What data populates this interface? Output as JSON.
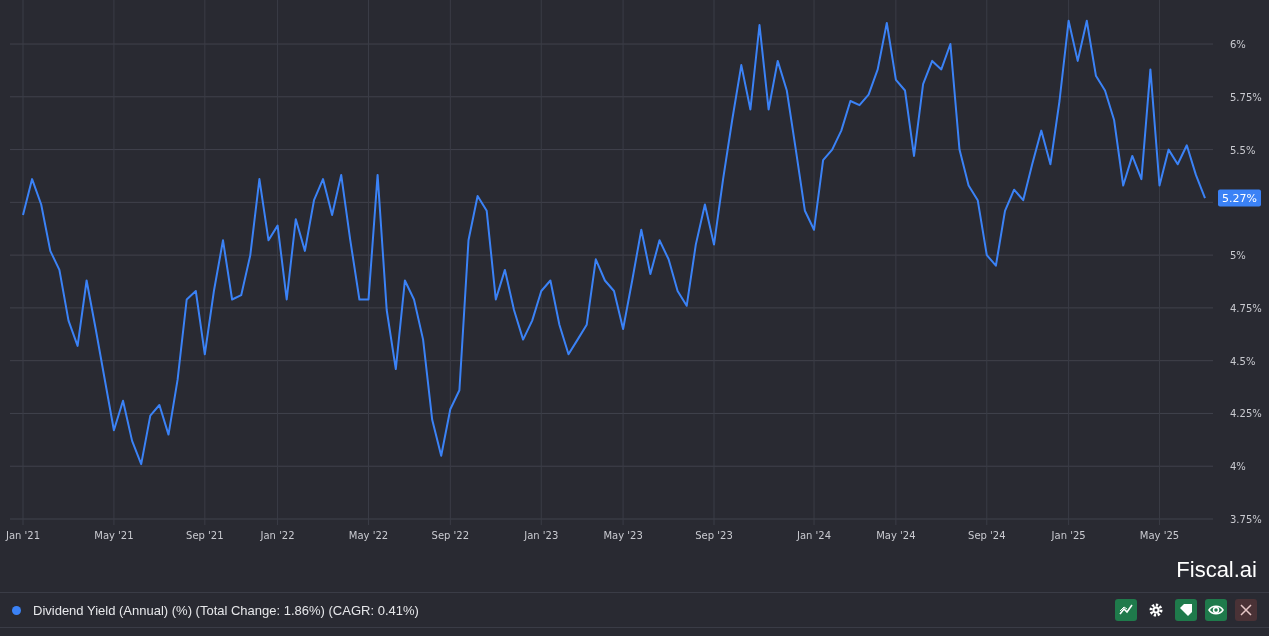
{
  "chart": {
    "chart_data": {
      "type": "line",
      "grid": true,
      "ylim": [
        3.75,
        6.2
      ],
      "yticks": [
        {
          "value": 3.75,
          "label": "3.75%"
        },
        {
          "value": 4,
          "label": "4%"
        },
        {
          "value": 4.25,
          "label": "4.25%"
        },
        {
          "value": 4.5,
          "label": "4.5%"
        },
        {
          "value": 4.75,
          "label": "4.75%"
        },
        {
          "value": 5,
          "label": "5%"
        },
        {
          "value": 5.5,
          "label": "5.5%"
        },
        {
          "value": 5.75,
          "label": "5.75%"
        },
        {
          "value": 6,
          "label": "6%"
        }
      ],
      "categories": [
        "Jan '21",
        null,
        null,
        null,
        null,
        null,
        null,
        null,
        null,
        null,
        "May '21",
        null,
        null,
        null,
        null,
        null,
        null,
        null,
        null,
        null,
        "Sep '21",
        null,
        null,
        null,
        null,
        null,
        null,
        null,
        "Jan '22",
        null,
        null,
        null,
        null,
        null,
        null,
        null,
        null,
        null,
        "May '22",
        null,
        null,
        null,
        null,
        null,
        null,
        null,
        null,
        "Sep '22",
        null,
        null,
        null,
        null,
        null,
        null,
        null,
        null,
        null,
        "Jan '23",
        null,
        null,
        null,
        null,
        null,
        null,
        null,
        null,
        "May '23",
        null,
        null,
        null,
        null,
        null,
        null,
        null,
        null,
        null,
        "Sep '23",
        null,
        null,
        null,
        null,
        null,
        null,
        null,
        null,
        null,
        null,
        "Jan '24",
        null,
        null,
        null,
        null,
        null,
        null,
        null,
        null,
        "May '24",
        null,
        null,
        null,
        null,
        null,
        null,
        null,
        null,
        null,
        "Sep '24",
        null,
        null,
        null,
        null,
        null,
        null,
        null,
        null,
        "Jan '25",
        null,
        null,
        null,
        null,
        null,
        null,
        null,
        null,
        null,
        "May '25",
        null,
        null,
        null,
        null,
        null
      ],
      "series": [
        {
          "name": "Dividend Yield (Annual) (%)",
          "color": "#3b82f6",
          "values": [
            5.19,
            5.36,
            5.24,
            5.02,
            4.93,
            4.69,
            4.57,
            4.88,
            4.65,
            4.41,
            4.17,
            4.31,
            4.12,
            4.01,
            4.24,
            4.29,
            4.15,
            4.41,
            4.79,
            4.83,
            4.53,
            4.83,
            5.07,
            4.79,
            4.81,
            5.0,
            5.36,
            5.07,
            5.14,
            4.79,
            5.17,
            5.02,
            5.26,
            5.36,
            5.19,
            5.38,
            5.07,
            4.79,
            4.79,
            5.38,
            4.74,
            4.46,
            4.88,
            4.79,
            4.6,
            4.22,
            4.05,
            4.27,
            4.36,
            5.07,
            5.28,
            5.21,
            4.79,
            4.93,
            4.74,
            4.6,
            4.69,
            4.83,
            4.88,
            4.67,
            4.53,
            4.6,
            4.67,
            4.98,
            4.88,
            4.83,
            4.65,
            4.88,
            5.12,
            4.91,
            5.07,
            4.98,
            4.83,
            4.76,
            5.05,
            5.24,
            5.05,
            5.36,
            5.64,
            5.9,
            5.69,
            6.09,
            5.69,
            5.92,
            5.78,
            5.5,
            5.21,
            5.12,
            5.45,
            5.5,
            5.59,
            5.73,
            5.71,
            5.76,
            5.88,
            6.1,
            5.83,
            5.78,
            5.47,
            5.81,
            5.92,
            5.88,
            6.0,
            5.5,
            5.33,
            5.26,
            5.0,
            4.95,
            5.21,
            5.31,
            5.26,
            5.43,
            5.59,
            5.43,
            5.73,
            6.11,
            5.92,
            6.11,
            5.85,
            5.78,
            5.64,
            5.33,
            5.47,
            5.36,
            5.88,
            5.33,
            5.5,
            5.43,
            5.52,
            5.38,
            5.27
          ]
        }
      ]
    },
    "last_value_label": "5.27%"
  },
  "brand": {
    "name": "Fiscal.ai"
  },
  "legend": {
    "summary": "(Total Change: 1.86%) (CAGR: 0.41%)"
  },
  "toolbar": [
    {
      "kind": "chart",
      "on": true
    },
    {
      "kind": "settings",
      "on": false
    },
    {
      "kind": "tag",
      "on": true
    },
    {
      "kind": "eye",
      "on": true
    },
    {
      "kind": "close",
      "on": false
    }
  ]
}
